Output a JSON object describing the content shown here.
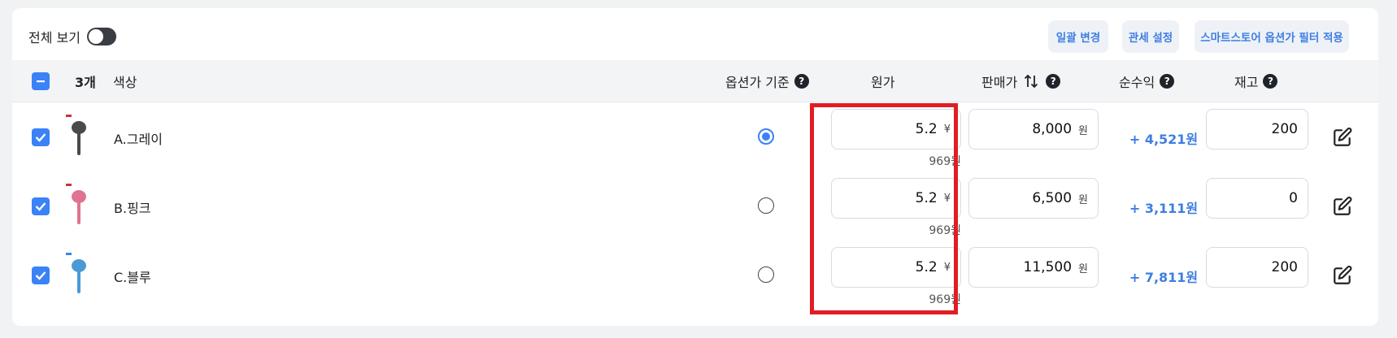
{
  "toolbar": {
    "view_all_label": "전체 보기",
    "view_all_on": false,
    "bulk_change": "일괄 변경",
    "customs_setting": "관세 설정",
    "smartstore_filter": "스마트스토어 옵션가 필터 적용"
  },
  "header": {
    "count": "3개",
    "color": "색상",
    "option_base": "옵션가 기준",
    "cost": "원가",
    "price": "판매가",
    "profit": "순수익",
    "stock": "재고",
    "help_glyph": "?"
  },
  "rows": [
    {
      "name": "A.그레이",
      "checked": true,
      "base": true,
      "cost": "5.2",
      "cost_unit": "¥",
      "cost_krw": "969원",
      "price": "8,000",
      "price_unit": "원",
      "profit": "+ 4,521원",
      "stock": "200",
      "thumb_color": "#4a4a4a"
    },
    {
      "name": "B.핑크",
      "checked": true,
      "base": false,
      "cost": "5.2",
      "cost_unit": "¥",
      "cost_krw": "969원",
      "price": "6,500",
      "price_unit": "원",
      "profit": "+ 3,111원",
      "stock": "0",
      "thumb_color": "#e0738f"
    },
    {
      "name": "C.블루",
      "checked": true,
      "base": false,
      "cost": "5.2",
      "cost_unit": "¥",
      "cost_krw": "969원",
      "price": "11,500",
      "price_unit": "원",
      "profit": "+ 7,811원",
      "stock": "200",
      "thumb_color": "#4a9ad6"
    }
  ],
  "colors": {
    "accent": "#3b82f6",
    "link": "#3f7ee0",
    "highlight": "#e11d24"
  },
  "icons": {
    "select_all": "minus-checkbox-icon",
    "row_check": "checkmark-icon",
    "sort": "sort-updown-icon",
    "edit": "edit-pencil-icon",
    "help": "question-circle-icon"
  }
}
